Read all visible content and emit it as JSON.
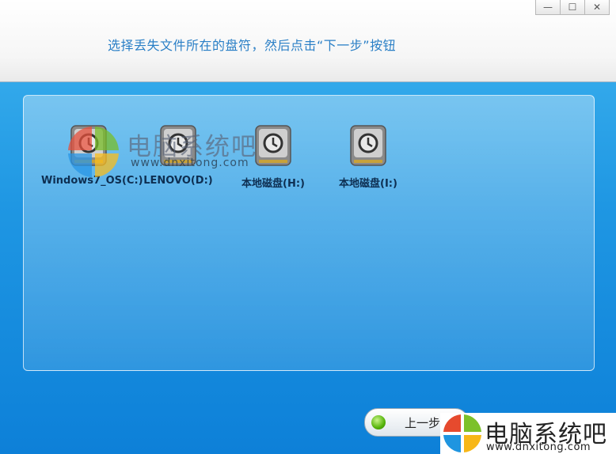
{
  "header": {
    "instruction": "选择丢失文件所在的盘符，然后点击“下一步”按钮"
  },
  "window_buttons": {
    "minimize": "—",
    "maximize": "☐",
    "close": "✕"
  },
  "drives": [
    {
      "label": "Windows7_OS(C:)"
    },
    {
      "label": "LENOVO(D:)"
    },
    {
      "label": "本地磁盘(H:)"
    },
    {
      "label": "本地磁盘(I:)"
    }
  ],
  "footer": {
    "prev_label": "上一步"
  },
  "watermark": {
    "name": "电脑系统吧",
    "url": "www.dnxitong.com",
    "url_small": "www.dnxitong.com"
  },
  "colors": {
    "instruction": "#2a7fc6",
    "background_top": "#3fb4ef",
    "background_bottom": "#0d80d8"
  }
}
